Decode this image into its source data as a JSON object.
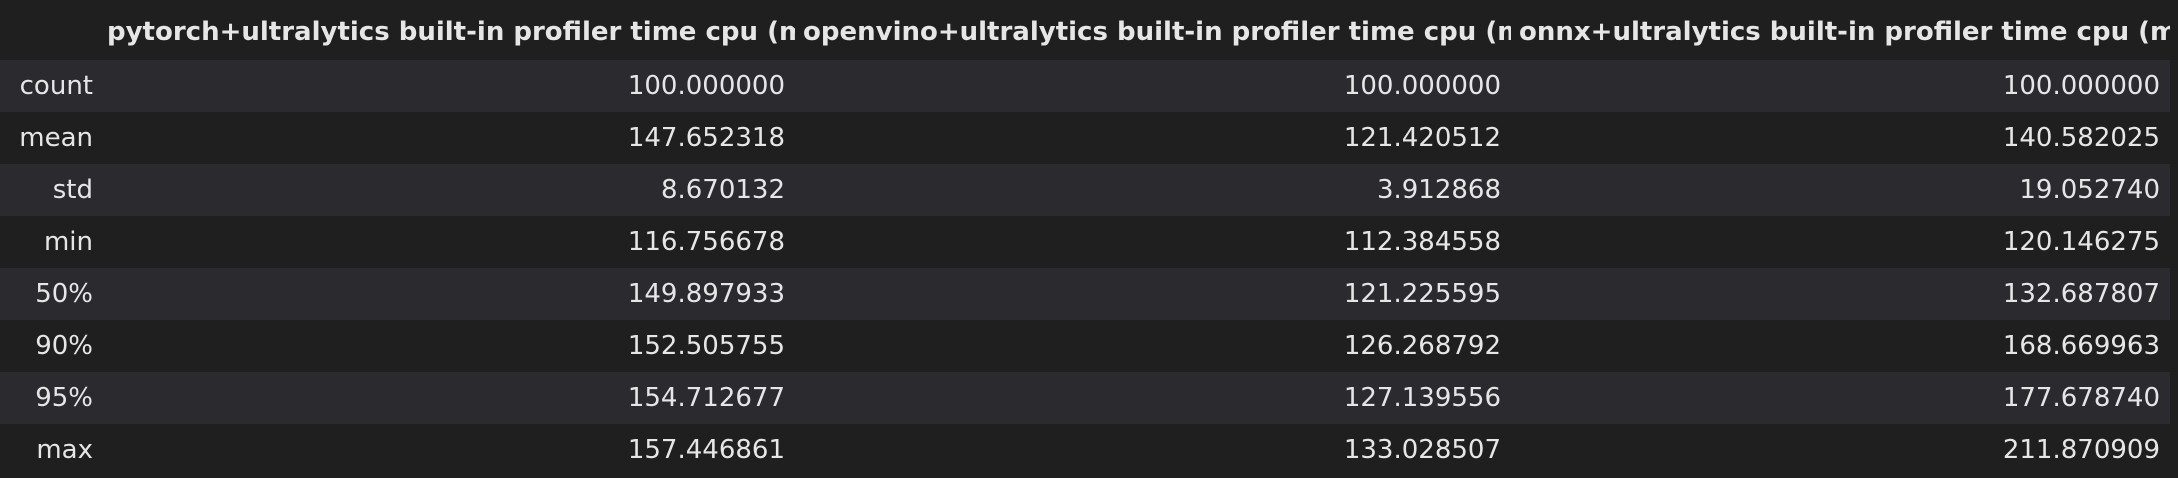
{
  "table": {
    "columns": [
      "",
      "pytorch+ultralytics built-in profiler time cpu (ms)",
      "openvino+ultralytics built-in profiler time cpu (ms)",
      "onnx+ultralytics built-in profiler time cpu (ms)"
    ],
    "rows": [
      {
        "label": "count",
        "values": [
          "100.000000",
          "100.000000",
          "100.000000"
        ]
      },
      {
        "label": "mean",
        "values": [
          "147.652318",
          "121.420512",
          "140.582025"
        ]
      },
      {
        "label": "std",
        "values": [
          "8.670132",
          "3.912868",
          "19.052740"
        ]
      },
      {
        "label": "min",
        "values": [
          "116.756678",
          "112.384558",
          "120.146275"
        ]
      },
      {
        "label": "50%",
        "values": [
          "149.897933",
          "121.225595",
          "132.687807"
        ]
      },
      {
        "label": "90%",
        "values": [
          "152.505755",
          "126.268792",
          "168.669963"
        ]
      },
      {
        "label": "95%",
        "values": [
          "154.712677",
          "127.139556",
          "177.678740"
        ]
      },
      {
        "label": "max",
        "values": [
          "157.446861",
          "133.028507",
          "211.870909"
        ]
      }
    ]
  },
  "colors": {
    "background": "#1f1f1f",
    "row_alt": "#2b2a2f",
    "text": "#e6e6e6"
  }
}
